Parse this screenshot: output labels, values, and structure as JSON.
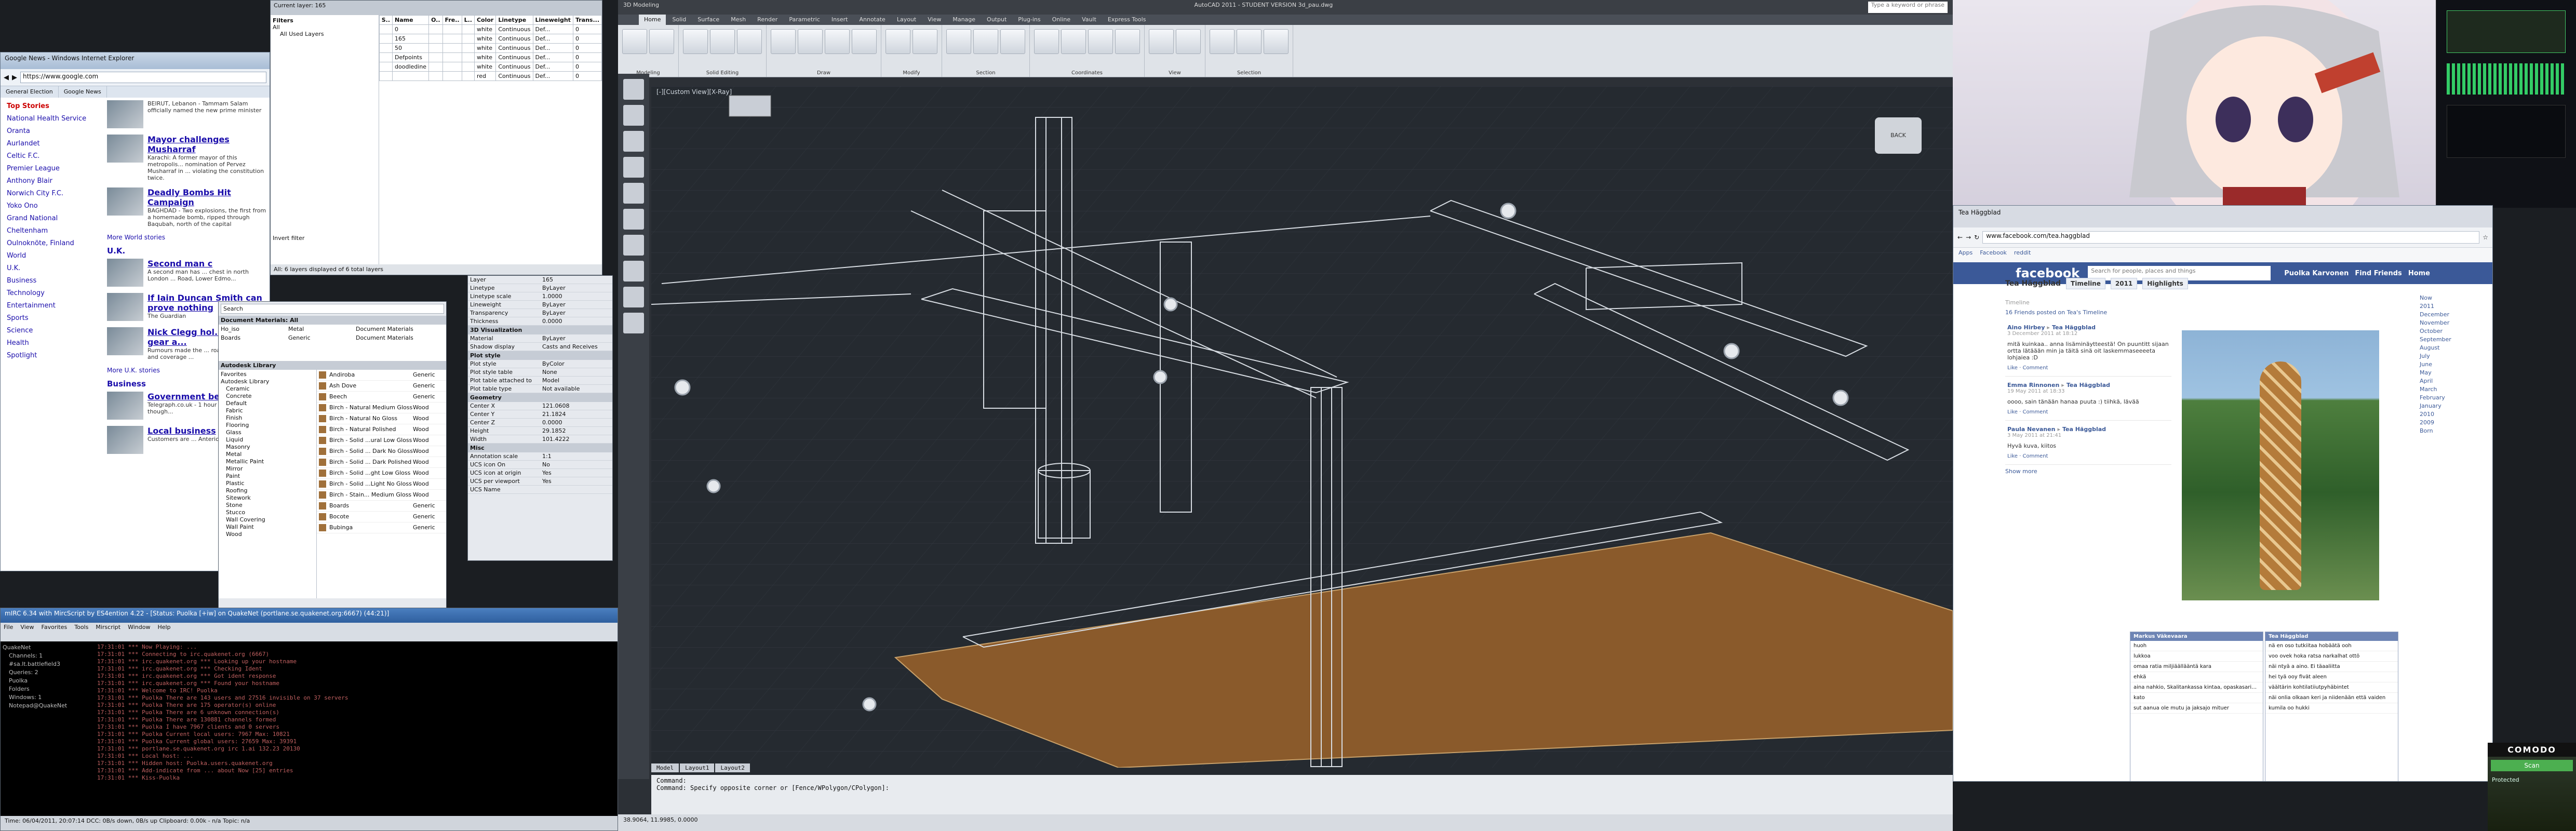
{
  "gnews": {
    "window_title": "Google News - Windows Internet Explorer",
    "url": "https://www.google.com",
    "tabs": [
      "General Election",
      "Google News"
    ],
    "nav": {
      "section": "Top Stories",
      "items": [
        "National Health Service",
        "Oranta",
        "Aurlandet",
        "Celtic F.C.",
        "Premier League",
        "Anthony Blair",
        "Norwich City F.C.",
        "Yoko Ono",
        "Grand National",
        "Cheltenham",
        "Oulnoknöte, Finland",
        "World",
        "U.K.",
        "Business",
        "Technology",
        "Entertainment",
        "Sports",
        "Science",
        "Health",
        "Spotlight"
      ]
    },
    "stories": [
      {
        "headline": "",
        "snippet": "BEIRUT, Lebanon - Tammam Salam officially named the new prime minister"
      },
      {
        "headline": "Mayor challenges Musharraf",
        "snippet": "Karachi: A former mayor of this metropolis... nomination of Pervez Musharraf in ... violating the constitution twice."
      },
      {
        "headline": "Deadly Bombs Hit Campaign",
        "snippet": "BAGHDAD - Two explosions, the first from a homemade bomb, ripped through Baqubah, north of the capital"
      }
    ],
    "more_world": "More World stories",
    "uk_head": "U.K.",
    "uk_stories": [
      {
        "headline": "Second man c",
        "snippet": "A second man has ... chest in north London ... Road, Lower Edmo..."
      },
      {
        "headline": "If Iain Duncan Smith can prove nothing",
        "snippet": "The Guardian"
      },
      {
        "headline": "Nick Clegg hol... £1300 gear a...",
        "snippet": "Rumours made the ... road £35,500 ... and coverage ..."
      }
    ],
    "more_uk": "More U.K. stories",
    "biz_head": "Business",
    "biz_stories": [
      {
        "headline": "Government be... fees",
        "snippet": "Telegraph.co.uk - 1 hour ago ... they pay, though..."
      },
      {
        "headline": "Local business",
        "snippet": "Customers are ... Anterior Caroline ..."
      }
    ]
  },
  "layer": {
    "current": "Current layer: 165",
    "filters": "Filters",
    "all": "All",
    "all_used": "All Used Layers",
    "invert": "Invert filter",
    "status": "All: 6 layers displayed of 6 total layers",
    "columns": [
      "S..",
      "Name",
      "O..",
      "Fre..",
      "L..",
      "Color",
      "Linetype",
      "Lineweight",
      "Trans..."
    ],
    "rows": [
      [
        "",
        "0",
        "",
        "",
        "",
        "white",
        "Continuous",
        "Def...",
        "0"
      ],
      [
        "",
        "165",
        "",
        "",
        "",
        "white",
        "Continuous",
        "Def...",
        "0"
      ],
      [
        "",
        "50",
        "",
        "",
        "",
        "white",
        "Continuous",
        "Def...",
        "0"
      ],
      [
        "",
        "Defpoints",
        "",
        "",
        "",
        "white",
        "Continuous",
        "Def...",
        "0"
      ],
      [
        "",
        "doodledine",
        "",
        "",
        "",
        "white",
        "Continuous",
        "Def...",
        "0"
      ],
      [
        "",
        "",
        "",
        "",
        "",
        "red",
        "Continuous",
        "Def...",
        "0"
      ]
    ]
  },
  "materials": {
    "search": "Search",
    "doc_head": "Document Materials: All",
    "doc_cols": [
      "Name",
      "Type",
      "Category"
    ],
    "doc_items": [
      [
        "Ho_iso",
        "Metal",
        "Document Materials"
      ],
      [
        "Boards",
        "Generic",
        "Document Materials"
      ]
    ],
    "lib_head": "Autodesk Library",
    "tree": [
      "Favorites",
      "Autodesk Library",
      "Ceramic",
      "Concrete",
      "Default",
      "Fabric",
      "Finish",
      "Flooring",
      "Glass",
      "Liquid",
      "Masonry",
      "Metal",
      "Metallic Paint",
      "Mirror",
      "Paint",
      "Plastic",
      "Roofing",
      "Sitework",
      "Stone",
      "Stucco",
      "Wall Covering",
      "Wall Paint",
      "Wood"
    ],
    "lib_cols": [
      "Name",
      "Type"
    ],
    "lib_items": [
      [
        "Andiroba",
        "Generic"
      ],
      [
        "Ash Dove",
        "Generic"
      ],
      [
        "Beech",
        "Generic"
      ],
      [
        "Birch - Natural Medium Gloss",
        "Wood"
      ],
      [
        "Birch - Natural No Gloss",
        "Wood"
      ],
      [
        "Birch - Natural Polished",
        "Wood"
      ],
      [
        "Birch - Solid ...ural Low Gloss",
        "Wood"
      ],
      [
        "Birch - Solid ... Dark No Gloss",
        "Wood"
      ],
      [
        "Birch - Solid ... Dark Polished",
        "Wood"
      ],
      [
        "Birch - Solid ...ght Low Gloss",
        "Wood"
      ],
      [
        "Birch - Solid ...Light No Gloss",
        "Wood"
      ],
      [
        "Birch - Stain... Medium Gloss",
        "Wood"
      ],
      [
        "Boards",
        "Generic"
      ],
      [
        "Bocote",
        "Generic"
      ],
      [
        "Bubinga",
        "Generic"
      ]
    ]
  },
  "props": {
    "groups": [
      {
        "name": "3D Visualization",
        "rows": [
          [
            "Material",
            "ByLayer"
          ],
          [
            "Shadow display",
            "Casts and Receives"
          ]
        ]
      },
      {
        "name": "Plot style",
        "rows": [
          [
            "Plot style",
            "ByColor"
          ],
          [
            "Plot style table",
            "None"
          ],
          [
            "Plot table attached to",
            "Model"
          ],
          [
            "Plot table type",
            "Not available"
          ]
        ]
      },
      {
        "name": "Geometry",
        "rows": [
          [
            "Center X",
            "121.0608"
          ],
          [
            "Center Y",
            "21.1824"
          ],
          [
            "Center Z",
            "0.0000"
          ],
          [
            "Height",
            "29.1852"
          ],
          [
            "Width",
            "101.4222"
          ]
        ]
      },
      {
        "name": "Misc",
        "rows": [
          [
            "Annotation scale",
            "1:1"
          ],
          [
            "UCS icon On",
            "No"
          ],
          [
            "UCS icon at origin",
            "Yes"
          ],
          [
            "UCS per viewport",
            "Yes"
          ],
          [
            "UCS Name",
            ""
          ]
        ]
      }
    ],
    "top_rows": [
      [
        "Layer",
        "165"
      ],
      [
        "Linetype",
        "ByLayer"
      ],
      [
        "Linetype scale",
        "1.0000"
      ],
      [
        "Lineweight",
        "ByLayer"
      ],
      [
        "Transparency",
        "ByLayer"
      ],
      [
        "Thickness",
        "0.0000"
      ]
    ]
  },
  "mirc": {
    "title": "mIRC 6.34 with MircScript by ES4ention 4.22 - [Status: Puolka [+iw] on QuakeNet (portlane.se.quakenet.org:6667) (44:21)]",
    "menu": [
      "File",
      "View",
      "Favorites",
      "Tools",
      "Mirscript",
      "Window",
      "Help"
    ],
    "tree": [
      "QuakeNet",
      "Channels: 1",
      "#sa.lt.battlefield3",
      "Queries: 2",
      "Puolka",
      "Folders",
      "Windows: 1",
      "Notepad@QuakeNet"
    ],
    "lines": [
      "17:31:01 *** Now Playing: ...",
      "17:31:01 *** Connecting to irc.quakenet.org (6667)",
      "17:31:01 *** irc.quakenet.org *** Looking up your hostname",
      "17:31:01 *** irc.quakenet.org *** Checking Ident",
      "17:31:01 *** irc.quakenet.org *** Got ident response",
      "17:31:01 *** irc.quakenet.org *** Found your hostname",
      "17:31:01 *** Welcome to IRC! Puolka",
      "17:31:01 *** Puolka There are 143 users and 27516 invisible on 37 servers",
      "17:31:01 *** Puolka There are 175 operator(s) online",
      "17:31:01 *** Puolka There are 6 unknown connection(s)",
      "17:31:01 *** Puolka There are 130881 channels formed",
      "17:31:01 *** Puolka I have 7967 clients and 0 servers",
      "17:31:01 *** Puolka Current local users: 7967 Max: 10821",
      "17:31:01 *** Puolka Current global users: 27659 Max: 39391",
      "17:31:01 *** portlane.se.quakenet.org irc 1.ai 132.23 20130",
      "17:31:01 *** Local host: ...",
      "17:31:01 *** Hidden host: Puolka.users.quakenet.org",
      "17:31:01 *** Add-indicate from ... about Now [25] entries",
      "17:31:01 *** Kiss-Puolka"
    ],
    "status": "Time: 06/04/2011, 20:07:14    DCC: 0B/s down, 0B/s up    Clipboard: 0.00k - n/a    Topic: n/a"
  },
  "acad": {
    "title": "AutoCAD 2011 - STUDENT VERSION   3d_pau.dwg",
    "search": "Type a keyword or phrase",
    "tabs": [
      "Home",
      "Solid",
      "Surface",
      "Mesh",
      "Render",
      "Parametric",
      "Insert",
      "Annotate",
      "Layout",
      "View",
      "Manage",
      "Output",
      "Plug-ins",
      "Online",
      "Vault",
      "Express Tools"
    ],
    "panels": [
      "Modeling",
      "Solid Editing",
      "Draw",
      "Modify",
      "Section",
      "Coordinates",
      "View",
      "Selection"
    ],
    "workspace": "3D Modeling",
    "viewport_label": "[-][Custom View][X-Ray]",
    "viewcube": "BACK",
    "layout_tabs": [
      "Model",
      "Layout1",
      "Layout2"
    ],
    "cmd_lines": [
      "Command:",
      "Command: Specify opposite corner or [Fence/WPolygon/CPolygon]:"
    ],
    "coords": "38.9064, 11.9985, 0.0000"
  },
  "fb": {
    "tab": "Tea Häggblad",
    "url": "www.facebook.com/tea.haggblad",
    "bookmarks": [
      "Apps",
      "Facebook",
      "reddit"
    ],
    "logo": "facebook",
    "search_placeholder": "Search for people, places and things",
    "nav": [
      "Puolka Karvonen",
      "Find Friends",
      "Home"
    ],
    "profile": "Tea Häggblad",
    "buttons": [
      "Timeline",
      "2011",
      "Highlights"
    ],
    "timeline_label": "Timeline",
    "posts_head": "16 Friends posted on Tea's Timeline",
    "posts": [
      {
        "who": "Aino Hirbey",
        "to": "Tea Häggblad",
        "meta": "3 December 2011 at 18:12",
        "body": "mitä kuinkaa.. anna lisäminäytteestä! On puuntitt sijaan ortta lätäään min ja täitä sinä oit laskemmaseeeeta lohjaiea :D",
        "act": "Like · Comment"
      },
      {
        "who": "Emma Rinnonen",
        "to": "Tea Häggblad",
        "meta": "19 May 2011 at 18:33",
        "body": "oooo, sain tänään hanaa puuta :) tiihkä, lävää",
        "act": "Like · Comment"
      },
      {
        "who": "Paula Nevanen",
        "to": "Tea Häggblad",
        "meta": "3 May 2011 at 21:41",
        "body": "Hyvä kuva, kiitos",
        "act": "Like · Comment"
      }
    ],
    "more": "Show more",
    "years": [
      "Now",
      "2011",
      "December",
      "November",
      "October",
      "September",
      "August",
      "July",
      "June",
      "May",
      "April",
      "March",
      "February",
      "January",
      "2010",
      "2009",
      "Born"
    ],
    "chat_left": {
      "name": "Markus Väkevaara",
      "msgs": [
        "huoh",
        "lukkoa",
        "omaa ratia miljiäällääntä kara",
        "ehkä",
        "aina nahkio, Skalitankassa kintaa, opaskasaria jonne",
        "kato",
        "sut aanua ole mutu ja jaksajo mituer"
      ]
    },
    "chat_right": {
      "name": "Tea Häggblad",
      "msgs": [
        "nä en oso tutkiitaa hobäätä ooh",
        "voo ovek hoka ratsa narkalhat ottö",
        "näi ntyä a aino. Ei täaaliitta",
        "hei tyä ooy fivät aleen",
        "väältärin kohtilatiiutpyhäbintet",
        "näi onlia olkaan keri ja niidenään että vaiden",
        "kumila oo hukki"
      ]
    }
  },
  "comodo": {
    "title": "COMODO",
    "button": "Scan",
    "line": "Protected"
  },
  "colors": {
    "acad_bg": "#252a30",
    "fb_blue": "#3b5998",
    "wood": "#8a5a2b",
    "wire": "#d8dde3"
  }
}
